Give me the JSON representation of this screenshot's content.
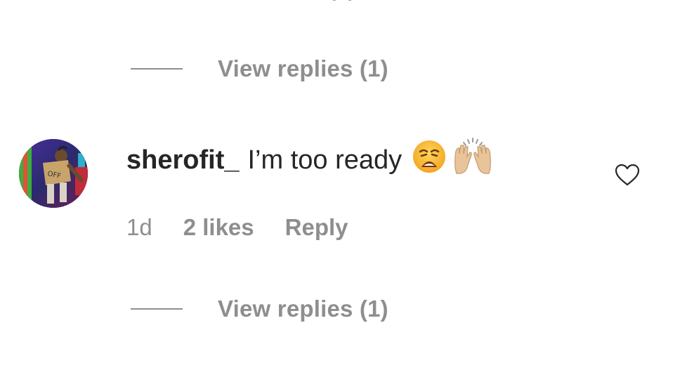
{
  "replies_top": {
    "label": "View replies (1)"
  },
  "comment": {
    "username": "sherofit_",
    "text": "I’m too ready",
    "emojis": [
      "weary-face-emoji",
      "raising-hands-emoji"
    ],
    "time": "1d",
    "likes": "2 likes",
    "reply_label": "Reply",
    "like_icon": "heart-outline-icon"
  },
  "replies_bottom": {
    "label": "View replies (1)"
  },
  "colors": {
    "text_primary": "#262626",
    "text_secondary": "#8e8e8e",
    "background": "#ffffff"
  }
}
